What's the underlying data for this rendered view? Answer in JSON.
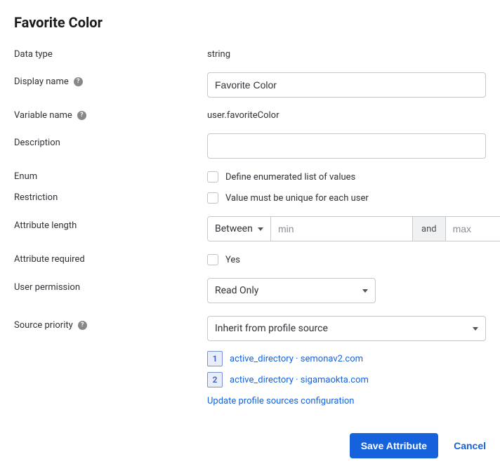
{
  "title": "Favorite Color",
  "labels": {
    "dataType": "Data type",
    "displayName": "Display name",
    "variableName": "Variable name",
    "description": "Description",
    "enum": "Enum",
    "restriction": "Restriction",
    "attributeLength": "Attribute length",
    "attributeRequired": "Attribute required",
    "userPermission": "User permission",
    "sourcePriority": "Source priority"
  },
  "values": {
    "dataType": "string",
    "displayName": "Favorite Color",
    "variableName": "user.favoriteColor",
    "description": "",
    "enumLabel": "Define enumerated list of values",
    "restrictionLabel": "Value must be unique for each user",
    "lengthMode": "Between",
    "lengthAnd": "and",
    "minPlaceholder": "min",
    "maxPlaceholder": "max",
    "requiredLabel": "Yes",
    "userPermission": "Read Only",
    "sourcePriority": "Inherit from profile source"
  },
  "sources": {
    "items": [
      {
        "num": "1",
        "label": "active_directory · semonav2.com"
      },
      {
        "num": "2",
        "label": "active_directory · sigamaokta.com"
      }
    ],
    "updateLink": "Update profile sources configuration"
  },
  "footer": {
    "save": "Save Attribute",
    "cancel": "Cancel"
  },
  "helpGlyph": "?"
}
